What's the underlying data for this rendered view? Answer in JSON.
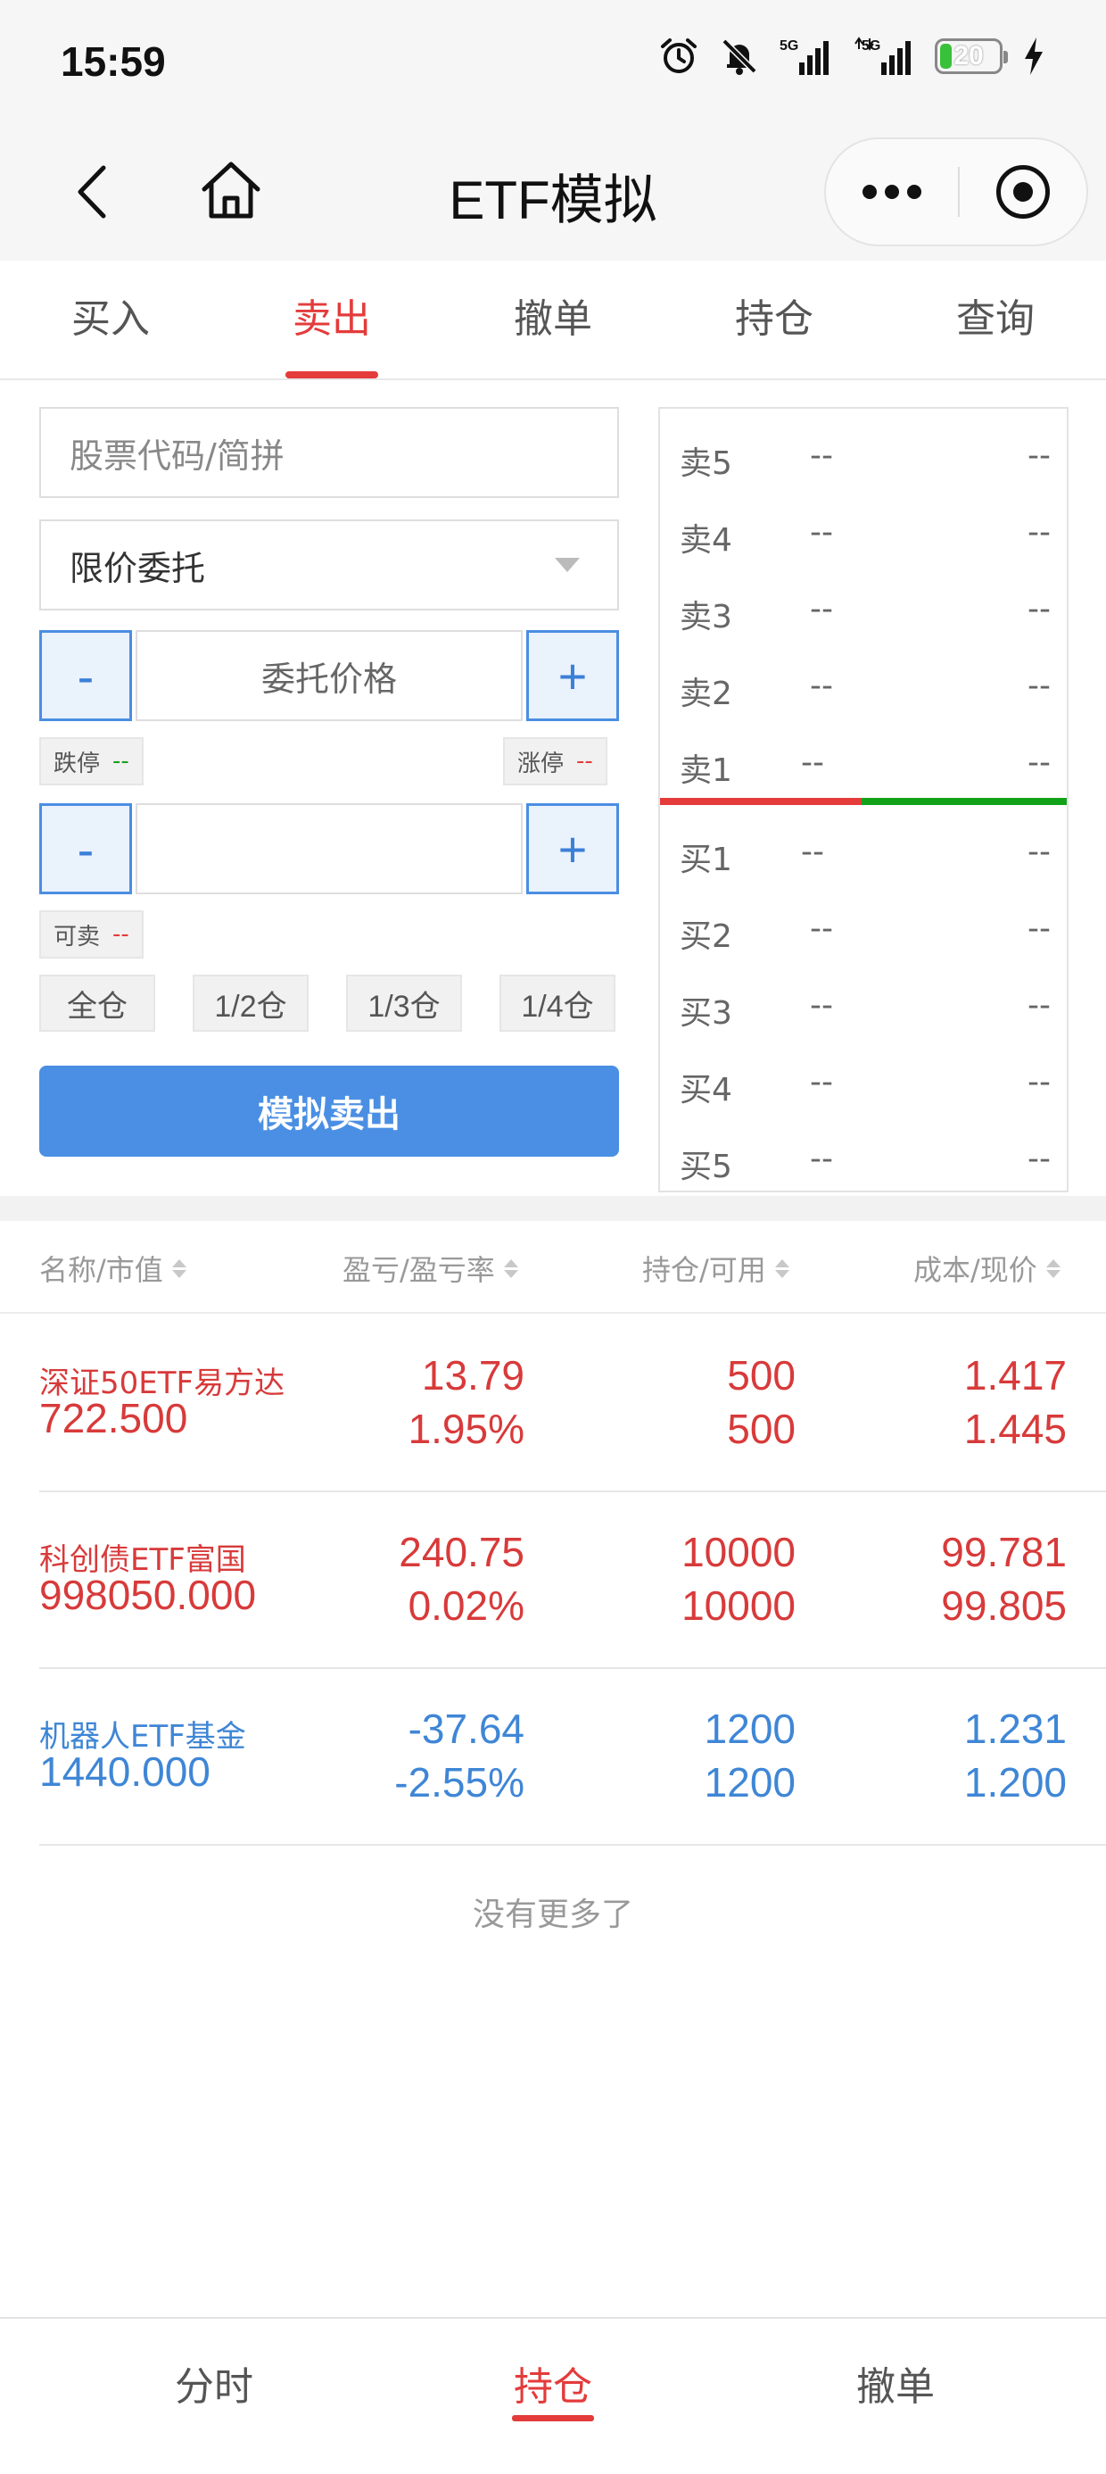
{
  "status_bar": {
    "time": "15:59",
    "battery": "20",
    "battery_level_percent": 20,
    "net1": "5G",
    "net2": "5G"
  },
  "nav": {
    "title": "ETF模拟"
  },
  "tabs": [
    {
      "label": "买入"
    },
    {
      "label": "卖出"
    },
    {
      "label": "撤单"
    },
    {
      "label": "持仓"
    },
    {
      "label": "查询"
    }
  ],
  "active_tab": "卖出",
  "form": {
    "stock_placeholder": "股票代码/简拼",
    "order_type": "限价委托",
    "price_placeholder": "委托价格",
    "minus": "-",
    "plus": "+",
    "limit_down_label": "跌停",
    "limit_down_value": "--",
    "limit_up_label": "涨停",
    "limit_up_value": "--",
    "quantity_value": "",
    "sellable_label": "可卖",
    "sellable_value": "--",
    "position_buttons": [
      "全仓",
      "1/2仓",
      "1/3仓",
      "1/4仓"
    ],
    "submit_label": "模拟卖出"
  },
  "order_book": {
    "asks": [
      {
        "label": "卖5",
        "price": "--",
        "volume": "--"
      },
      {
        "label": "卖4",
        "price": "--",
        "volume": "--"
      },
      {
        "label": "卖3",
        "price": "--",
        "volume": "--"
      },
      {
        "label": "卖2",
        "price": "--",
        "volume": "--"
      },
      {
        "label": "卖1",
        "price": "--",
        "volume": "--"
      }
    ],
    "bids": [
      {
        "label": "买1",
        "price": "--",
        "volume": "--"
      },
      {
        "label": "买2",
        "price": "--",
        "volume": "--"
      },
      {
        "label": "买3",
        "price": "--",
        "volume": "--"
      },
      {
        "label": "买4",
        "price": "--",
        "volume": "--"
      },
      {
        "label": "买5",
        "price": "--",
        "volume": "--"
      }
    ]
  },
  "positions": {
    "headers": [
      "名称/市值",
      "盈亏/盈亏率",
      "持仓/可用",
      "成本/现价"
    ],
    "rows": [
      {
        "name": "深证50ETF易方达",
        "market_value": "722.500",
        "pnl": "13.79",
        "pnl_rate": "1.95%",
        "holding": "500",
        "available": "500",
        "cost": "1.417",
        "price": "1.445",
        "color": "#d83a3a"
      },
      {
        "name": "科创债ETF富国",
        "market_value": "998050.000",
        "pnl": "240.75",
        "pnl_rate": "0.02%",
        "holding": "10000",
        "available": "10000",
        "cost": "99.781",
        "price": "99.805",
        "color": "#d83a3a"
      },
      {
        "name": "机器人ETF基金",
        "market_value": "1440.000",
        "pnl": "-37.64",
        "pnl_rate": "-2.55%",
        "holding": "1200",
        "available": "1200",
        "cost": "1.231",
        "price": "1.200",
        "color": "#3f86d6"
      }
    ],
    "no_more": "没有更多了"
  },
  "bottom_nav": [
    {
      "label": "分时"
    },
    {
      "label": "持仓"
    },
    {
      "label": "撤单"
    }
  ],
  "bottom_active": "持仓",
  "colors": {
    "accent_red": "#e43b3b",
    "accent_blue": "#4a8fe3",
    "up_red": "#d83a3a",
    "down_blue": "#3f86d6",
    "green": "#12a21a"
  }
}
